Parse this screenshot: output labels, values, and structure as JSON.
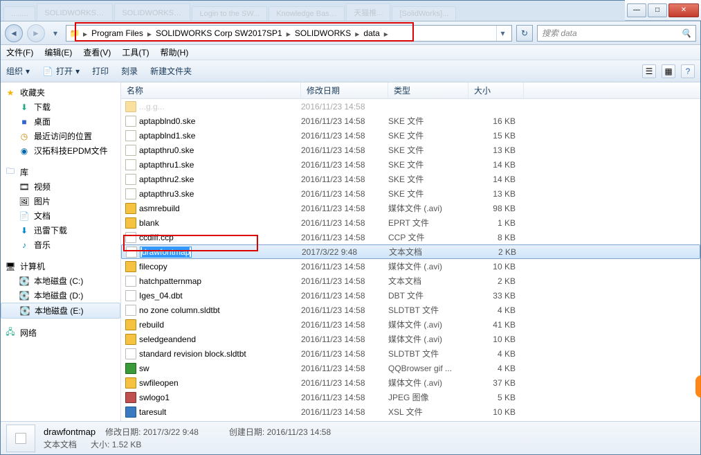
{
  "window": {
    "min": "—",
    "max": "□",
    "close": "✕"
  },
  "tabs": [
    "........",
    "SOLIDWORKS推...",
    "SOLIDWORKS推 (...",
    "Login to the SW...",
    "Knowledge Base...",
    "天猫推...",
    "[SolidWorks]..."
  ],
  "breadcrumb": {
    "icon": "📁",
    "parts": [
      "Program Files",
      "SOLIDWORKS Corp SW2017SP1",
      "SOLIDWORKS",
      "data"
    ]
  },
  "search": {
    "placeholder": "搜索 data",
    "icon": "🔍"
  },
  "menus": [
    "文件(F)",
    "编辑(E)",
    "查看(V)",
    "工具(T)",
    "帮助(H)"
  ],
  "toolbar": {
    "org": "组织",
    "open": "打开",
    "print": "打印",
    "burn": "刻录",
    "newfolder": "新建文件夹",
    "view_icon": "☰",
    "pane_icon": "▦",
    "help_icon": "?"
  },
  "sidebar": {
    "fav": {
      "head": "收藏夹",
      "items": [
        "下载",
        "桌面",
        "最近访问的位置",
        "汉拓科技EPDM文件"
      ]
    },
    "lib": {
      "head": "库",
      "items": [
        "视频",
        "图片",
        "文档",
        "迅雷下载",
        "音乐"
      ]
    },
    "comp": {
      "head": "计算机",
      "items": [
        "本地磁盘 (C:)",
        "本地磁盘 (D:)",
        "本地磁盘 (E:)"
      ]
    },
    "net": {
      "head": "网络"
    }
  },
  "columns": {
    "name": "名称",
    "date": "修改日期",
    "type": "类型",
    "size": "大小"
  },
  "files": [
    {
      "n": "aptapblnd0.ske",
      "d": "2016/11/23 14:58",
      "t": "SKE 文件",
      "s": "16 KB",
      "i": "ske"
    },
    {
      "n": "aptapblnd1.ske",
      "d": "2016/11/23 14:58",
      "t": "SKE 文件",
      "s": "15 KB",
      "i": "ske"
    },
    {
      "n": "aptapthru0.ske",
      "d": "2016/11/23 14:58",
      "t": "SKE 文件",
      "s": "13 KB",
      "i": "ske"
    },
    {
      "n": "aptapthru1.ske",
      "d": "2016/11/23 14:58",
      "t": "SKE 文件",
      "s": "14 KB",
      "i": "ske"
    },
    {
      "n": "aptapthru2.ske",
      "d": "2016/11/23 14:58",
      "t": "SKE 文件",
      "s": "14 KB",
      "i": "ske"
    },
    {
      "n": "aptapthru3.ske",
      "d": "2016/11/23 14:58",
      "t": "SKE 文件",
      "s": "13 KB",
      "i": "ske"
    },
    {
      "n": "asmrebuild",
      "d": "2016/11/23 14:58",
      "t": "媒体文件 (.avi)",
      "s": "98 KB",
      "i": "avi"
    },
    {
      "n": "blank",
      "d": "2016/11/23 14:58",
      "t": "EPRT 文件",
      "s": "1 KB",
      "i": "eprt"
    },
    {
      "n": "ccdiff.ccp",
      "d": "2016/11/23 14:58",
      "t": "CCP 文件",
      "s": "8 KB",
      "i": "txt"
    },
    {
      "n": "drawfontmap",
      "d": "2017/3/22 9:48",
      "t": "文本文档",
      "s": "2 KB",
      "i": "txt",
      "sel": true
    },
    {
      "n": "filecopy",
      "d": "2016/11/23 14:58",
      "t": "媒体文件 (.avi)",
      "s": "10 KB",
      "i": "avi"
    },
    {
      "n": "hatchpatternmap",
      "d": "2016/11/23 14:58",
      "t": "文本文档",
      "s": "2 KB",
      "i": "txt"
    },
    {
      "n": "Iges_04.dbt",
      "d": "2016/11/23 14:58",
      "t": "DBT 文件",
      "s": "33 KB",
      "i": "txt"
    },
    {
      "n": "no zone column.sldtbt",
      "d": "2016/11/23 14:58",
      "t": "SLDTBT 文件",
      "s": "4 KB",
      "i": "txt"
    },
    {
      "n": "rebuild",
      "d": "2016/11/23 14:58",
      "t": "媒体文件 (.avi)",
      "s": "41 KB",
      "i": "avi"
    },
    {
      "n": "seledgeandend",
      "d": "2016/11/23 14:58",
      "t": "媒体文件 (.avi)",
      "s": "10 KB",
      "i": "avi"
    },
    {
      "n": "standard revision block.sldtbt",
      "d": "2016/11/23 14:58",
      "t": "SLDTBT 文件",
      "s": "4 KB",
      "i": "txt"
    },
    {
      "n": "sw",
      "d": "2016/11/23 14:58",
      "t": "QQBrowser gif ...",
      "s": "4 KB",
      "i": "gif"
    },
    {
      "n": "swfileopen",
      "d": "2016/11/23 14:58",
      "t": "媒体文件 (.avi)",
      "s": "37 KB",
      "i": "avi"
    },
    {
      "n": "swlogo1",
      "d": "2016/11/23 14:58",
      "t": "JPEG 图像",
      "s": "5 KB",
      "i": "jpeg"
    },
    {
      "n": "taresult",
      "d": "2016/11/23 14:58",
      "t": "XSL 文件",
      "s": "10 KB",
      "i": "xsl"
    }
  ],
  "details": {
    "name": "drawfontmap",
    "type": "文本文档",
    "modlabel": "修改日期:",
    "mod": "2017/3/22 9:48",
    "createdlabel": "创建日期:",
    "created": "2016/11/23 14:58",
    "sizelabel": "大小:",
    "size": "1.52 KB"
  }
}
